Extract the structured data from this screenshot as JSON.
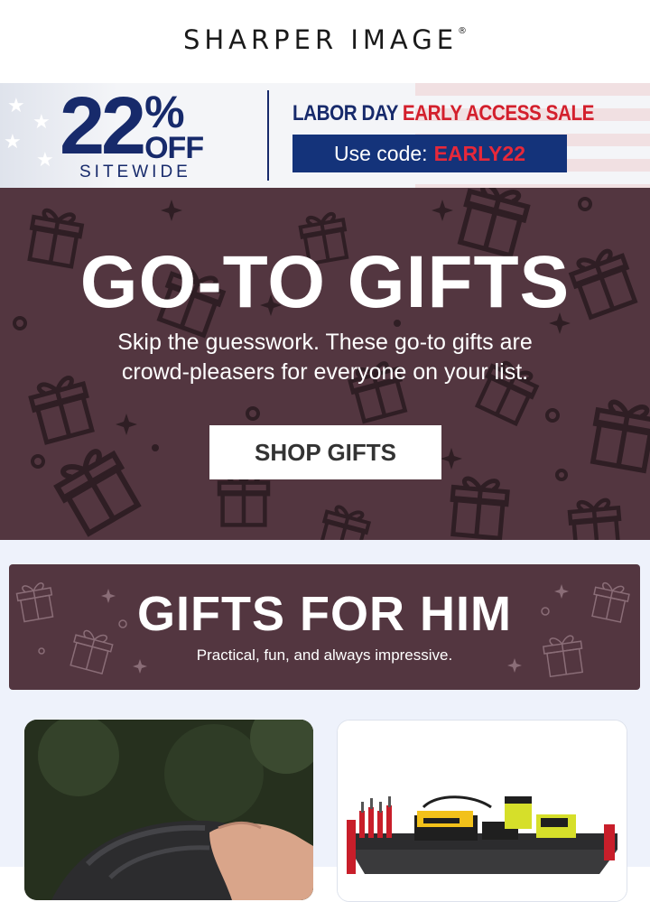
{
  "header": {
    "logo_text": "SHARPER IMAGE",
    "logo_mark": "®"
  },
  "promo": {
    "percent": "22",
    "percent_sign": "%",
    "off": "OFF",
    "sitewide": "SITEWIDE",
    "sale_prefix": "LABOR DAY",
    "sale_highlight": "EARLY ACCESS SALE",
    "code_label": "Use code:",
    "code": "EARLY22",
    "colors": {
      "navy": "#172a6b",
      "red": "#d31f2c"
    }
  },
  "hero": {
    "title": "GO-TO GIFTS",
    "subtitle_line1": "Skip the guesswork. These go-to gifts are",
    "subtitle_line2": "crowd-pleasers for everyone on your list.",
    "button_label": "SHOP GIFTS",
    "background_color": "#533640"
  },
  "him_section": {
    "title": "GIFTS FOR HIM",
    "subtitle": "Practical, fun, and always impressive."
  },
  "products": [
    {
      "image": "massage-device-photo"
    },
    {
      "image": "power-tool-charging-station-photo"
    }
  ]
}
